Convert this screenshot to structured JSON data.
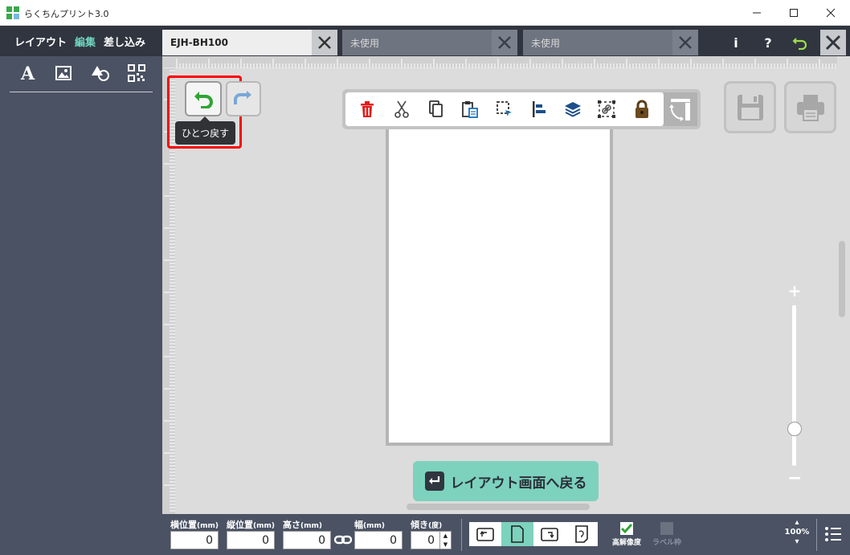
{
  "window": {
    "title": "らくちんプリント3.0",
    "controls": [
      "minimize",
      "maximize",
      "close"
    ]
  },
  "sidebar": {
    "mode_tabs": [
      {
        "label": "レイアウト",
        "active": false
      },
      {
        "label": "編集",
        "active": true
      },
      {
        "label": "差し込み",
        "active": false
      }
    ],
    "tools": [
      "text-icon",
      "image-icon",
      "shape-icon",
      "qrcode-icon"
    ]
  },
  "tabs": [
    {
      "label": "EJH-BH100",
      "active": true
    },
    {
      "label": "未使用",
      "active": false
    },
    {
      "label": "未使用",
      "active": false
    }
  ],
  "header_buttons": {
    "info": "i",
    "help": "?"
  },
  "history": {
    "undo_tooltip": "ひとつ戻す"
  },
  "edit_toolbar": [
    "delete-icon",
    "cut-icon",
    "copy-icon",
    "paste-icon",
    "select-icon",
    "align-icon",
    "layers-icon",
    "group-icon",
    "lock-icon"
  ],
  "zoom": {
    "plus": "+",
    "minus": "−",
    "level_label": "100%",
    "level_fraction": 0.23
  },
  "back_button": {
    "label": "レイアウト画面へ戻る"
  },
  "properties": {
    "x": {
      "label": "横位置",
      "unit": "(mm)",
      "value": "0"
    },
    "y": {
      "label": "縦位置",
      "unit": "(mm)",
      "value": "0"
    },
    "height": {
      "label": "高さ",
      "unit": "(mm)",
      "value": "0"
    },
    "width": {
      "label": "幅",
      "unit": "(mm)",
      "value": "0"
    },
    "angle": {
      "label": "傾き",
      "unit": "(度)",
      "value": "0"
    }
  },
  "options": {
    "high_res": {
      "label": "高解像度",
      "checked": true
    },
    "label_frame": {
      "label": "ラベル枠",
      "checked": false
    }
  },
  "colors": {
    "accent": "#7dd2bd",
    "sidebar": "#4a5263",
    "header": "#30353f",
    "highlight": "#ff0000"
  }
}
